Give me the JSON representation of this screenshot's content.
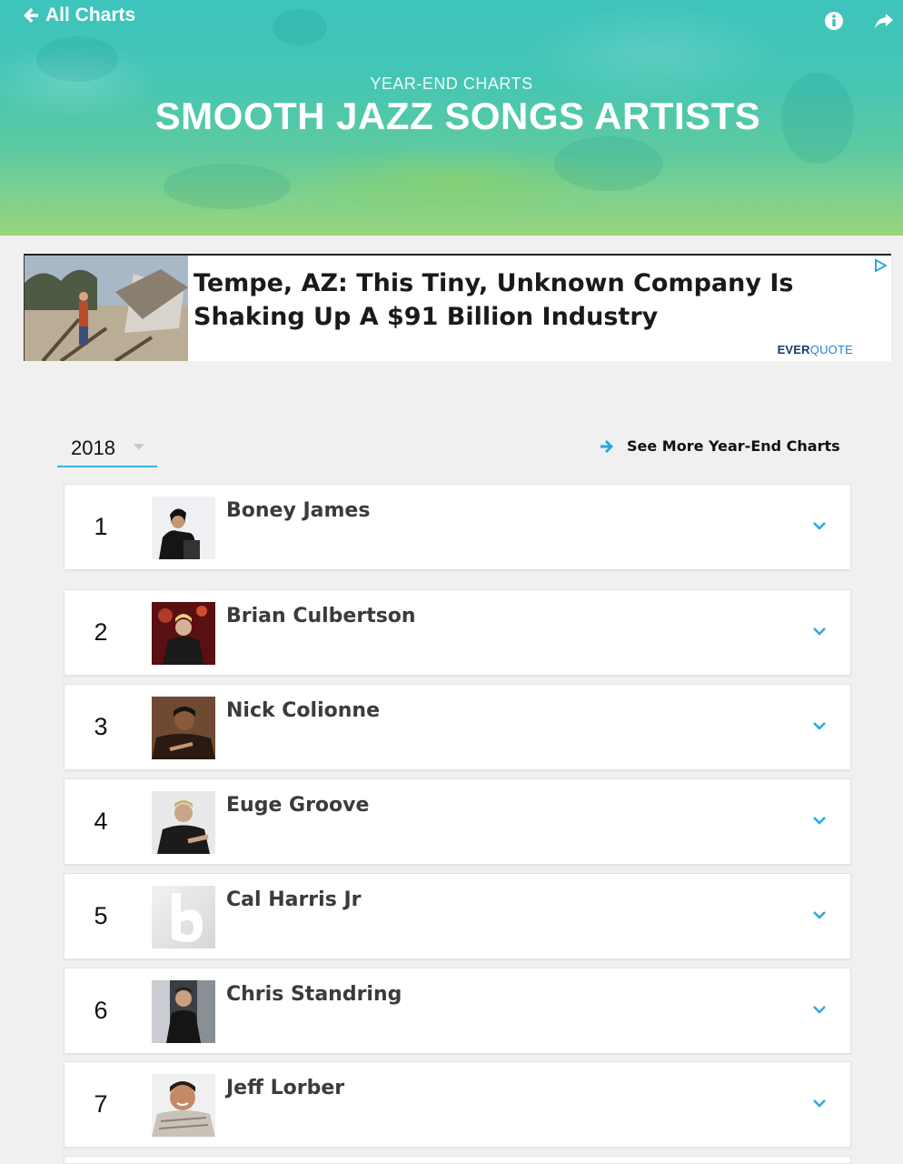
{
  "nav": {
    "back_label": "All Charts"
  },
  "hero": {
    "eyebrow": "YEAR-END CHARTS",
    "title": "SMOOTH JAZZ SONGS ARTISTS"
  },
  "ad": {
    "headline": "Tempe, AZ: This Tiny, Unknown Company Is Shaking Up A $91 Billion Industry",
    "brand_part1": "EVER",
    "brand_part2": "QUOTE"
  },
  "controls": {
    "year": "2018",
    "see_more_label": "See More Year-End Charts"
  },
  "chart_rows": [
    {
      "rank": "1",
      "artist": "Boney James"
    },
    {
      "rank": "2",
      "artist": "Brian Culbertson"
    },
    {
      "rank": "3",
      "artist": "Nick Colionne"
    },
    {
      "rank": "4",
      "artist": "Euge Groove"
    },
    {
      "rank": "5",
      "artist": "Cal Harris Jr"
    },
    {
      "rank": "6",
      "artist": "Chris Standring"
    },
    {
      "rank": "7",
      "artist": "Jeff Lorber"
    }
  ],
  "colors": {
    "accent": "#38b6e0",
    "hero_top": "#3dc4bd",
    "hero_bottom": "#9ad67d"
  },
  "icons": [
    "arrow-left-icon",
    "info-icon",
    "share-icon",
    "ad-choices-icon",
    "caret-down-icon",
    "arrow-right-icon",
    "chevron-down-icon"
  ]
}
